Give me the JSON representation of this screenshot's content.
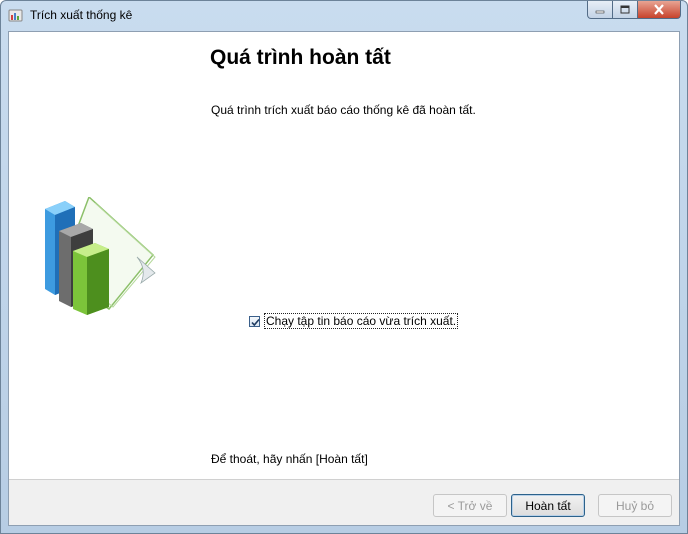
{
  "window": {
    "title": "Trích xuất thống kê"
  },
  "page": {
    "heading": "Quá trình hoàn tất",
    "description": "Quá trình trích xuất báo cáo thống kê đã hoàn tất.",
    "illustration_icon": "bar-chart-report-icon",
    "checkbox": {
      "label": "Chạy tập tin báo cáo vừa trích xuất.",
      "checked": true
    },
    "exit_hint": "Để thoát, hãy nhấn [Hoàn tất]"
  },
  "footer": {
    "back_label": "< Trở về",
    "finish_label": "Hoàn tất",
    "cancel_label": "Huỷ bỏ"
  },
  "colors": {
    "title_bar": "#c9dcef",
    "client_bg": "#ffffff",
    "footer_bg": "#f0f0f0",
    "close_button": "#c7432c",
    "checkbox_border": "#3a5f8a"
  }
}
